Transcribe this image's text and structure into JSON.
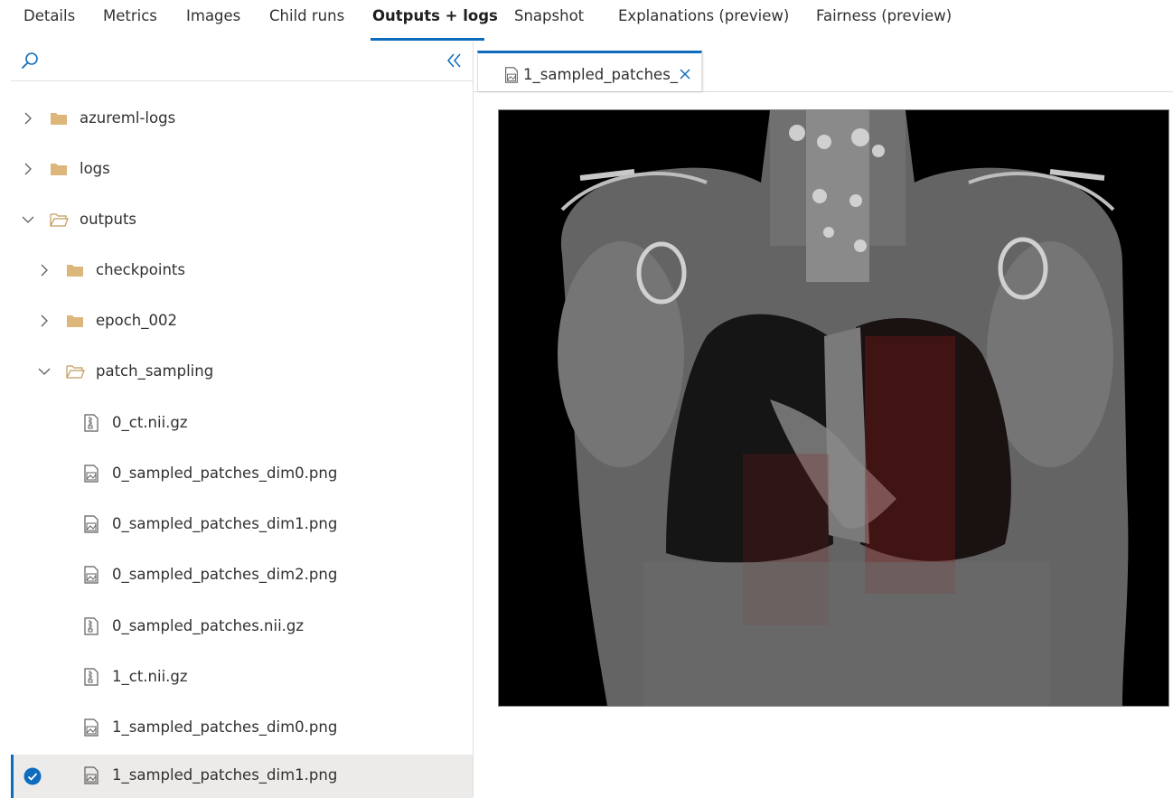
{
  "top_tabs": [
    {
      "label": "Details"
    },
    {
      "label": "Metrics"
    },
    {
      "label": "Images"
    },
    {
      "label": "Child runs"
    },
    {
      "label": "Outputs + logs",
      "active": true
    },
    {
      "label": "Snapshot"
    },
    {
      "label": "Explanations (preview)"
    },
    {
      "label": "Fairness (preview)"
    }
  ],
  "icons": {
    "search": "search-icon",
    "collapse": "double-chevron-left-icon",
    "folder_closed": "folder-icon",
    "folder_open": "folder-open-icon",
    "file_zip": "zip-file-icon",
    "file_image": "image-file-icon",
    "selected": "check-circle-icon"
  },
  "colors": {
    "accent": "#0f6cbd",
    "folder": "#dcb67a",
    "selected_row": "#edebe9"
  },
  "tree": [
    {
      "label": "azureml-logs",
      "type": "folder",
      "expanded": false,
      "depth": 0
    },
    {
      "label": "logs",
      "type": "folder",
      "expanded": false,
      "depth": 0
    },
    {
      "label": "outputs",
      "type": "folder",
      "expanded": true,
      "depth": 0
    },
    {
      "label": "checkpoints",
      "type": "folder",
      "expanded": false,
      "depth": 1
    },
    {
      "label": "epoch_002",
      "type": "folder",
      "expanded": false,
      "depth": 1
    },
    {
      "label": "patch_sampling",
      "type": "folder",
      "expanded": true,
      "depth": 1
    },
    {
      "label": "0_ct.nii.gz",
      "type": "zip",
      "depth": 2
    },
    {
      "label": "0_sampled_patches_dim0.png",
      "type": "image",
      "depth": 2
    },
    {
      "label": "0_sampled_patches_dim1.png",
      "type": "image",
      "depth": 2
    },
    {
      "label": "0_sampled_patches_dim2.png",
      "type": "image",
      "depth": 2
    },
    {
      "label": "0_sampled_patches.nii.gz",
      "type": "zip",
      "depth": 2
    },
    {
      "label": "1_ct.nii.gz",
      "type": "zip",
      "depth": 2
    },
    {
      "label": "1_sampled_patches_dim0.png",
      "type": "image",
      "depth": 2
    },
    {
      "label": "1_sampled_patches_dim1.png",
      "type": "image",
      "depth": 2,
      "selected": true
    }
  ],
  "open_file_tab": {
    "label": "1_sampled_patches_",
    "close_icon": "close-icon"
  },
  "viewer": {
    "content": "ct-scan-image"
  }
}
